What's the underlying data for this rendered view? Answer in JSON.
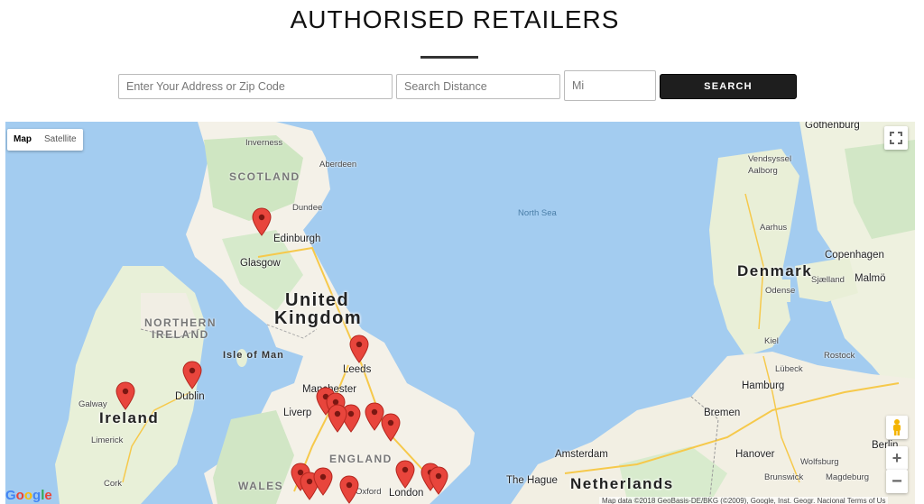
{
  "page": {
    "title": "AUTHORISED RETAILERS"
  },
  "search": {
    "address_placeholder": "Enter Your Address or Zip Code",
    "distance_placeholder": "Search Distance",
    "unit_placeholder": "Mi",
    "button_label": "SEARCH"
  },
  "map": {
    "type_control": {
      "map_label": "Map",
      "satellite_label": "Satellite"
    },
    "labels": {
      "gothenburg": "Gothenburg",
      "inverness": "Inverness",
      "scotland": "SCOTLAND",
      "aberdeen": "Aberdeen",
      "vendsyssel": "Vendsyssel",
      "aalborg": "Aalborg",
      "dundee": "Dundee",
      "north_sea": "North Sea",
      "edinburgh": "Edinburgh",
      "glasgow": "Glasgow",
      "aarhus": "Aarhus",
      "copenhagen": "Copenhagen",
      "denmark": "Denmark",
      "sjaelland": "Sjælland",
      "malmo": "Malmö",
      "odense": "Odense",
      "uk_line1": "United",
      "uk_line2": "Kingdom",
      "northern_line1": "NORTHERN",
      "northern_line2": "IRELAND",
      "isle_of_man": "Isle of Man",
      "leeds": "Leeds",
      "kiel": "Kiel",
      "rostock": "Rostock",
      "lubeck": "Lübeck",
      "galway": "Galway",
      "dublin": "Dublin",
      "manchester": "Manchester",
      "hamburg": "Hamburg",
      "ireland": "Ireland",
      "liverpool": "Liverp",
      "bremen": "Bremen",
      "limerick": "Limerick",
      "england": "ENGLAND",
      "amsterdam": "Amsterdam",
      "hanover": "Hanover",
      "berlin": "Berlin",
      "wolfsburg": "Wolfsburg",
      "cork": "Cork",
      "wales": "WALES",
      "oxford": "Oxford",
      "london": "London",
      "the_hague": "The Hague",
      "netherlands": "Netherlands",
      "brunswick": "Brunswick",
      "magdeburg": "Magdeburg"
    },
    "attribution": "Map data ©2018 GeoBasis-DE/BKG (©2009), Google, Inst. Geogr. Nacional   Terms of Us",
    "google_logo": "Google",
    "marker_color": "#e8453c",
    "icons": {
      "fullscreen": "fullscreen-icon",
      "pegman": "pegman-icon",
      "zoom_in": "plus-icon",
      "zoom_out": "minus-icon"
    }
  }
}
